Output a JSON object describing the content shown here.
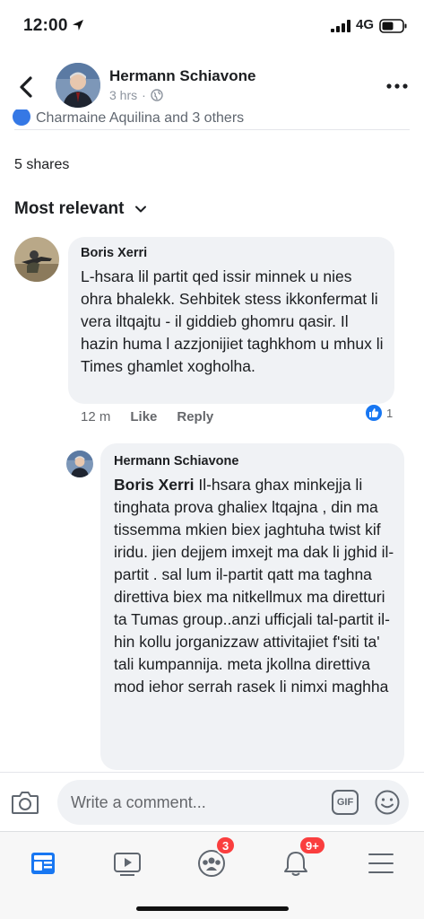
{
  "status_bar": {
    "time": "12:00",
    "network": "4G"
  },
  "post": {
    "author": "Hermann Schiavone",
    "time": "3 hrs",
    "reactions_text": "Charmaine Aquilina and 3 others",
    "shares": "5 shares"
  },
  "sort": {
    "label": "Most relevant"
  },
  "comments": [
    {
      "name": "Boris Xerri",
      "text": "L-hsara lil partit qed issir minnek u nies ohra bhalekk. Sehbitek stess ikkonfermat li vera iltqajtu - il giddieb ghomru qasir. Il hazin huma l azzjonijiet taghkhom u mhux li Times ghamlet xogholha.",
      "time": "12 m",
      "like_label": "Like",
      "reply_label": "Reply",
      "like_count": "1"
    },
    {
      "name": "Hermann Schiavone",
      "mention": "Boris Xerri",
      "text": "Il-hsara ghax minkejja li tinghata prova ghaliex ltqajna , din ma tissemma mkien biex jaghtuha twist kif iridu. jien dejjem imxejt ma dak li jghid il-partit . sal lum il-partit qatt ma taghna direttiva biex ma nitkellmux ma diretturi ta Tumas group..anzi ufficjali tal-partit il-hin kollu jorganizzaw attivitajiet f'siti ta' tali kumpannija. meta jkollna direttiva mod iehor serrah rasek li nimxi maghha"
    }
  ],
  "composer": {
    "placeholder": "Write a comment...",
    "gif_label": "GIF"
  },
  "tabbar": {
    "groups_badge": "3",
    "notifications_badge": "9+"
  },
  "colors": {
    "accent": "#1877f2",
    "badge": "#fa3e3e",
    "bubble": "#f0f2f5"
  }
}
